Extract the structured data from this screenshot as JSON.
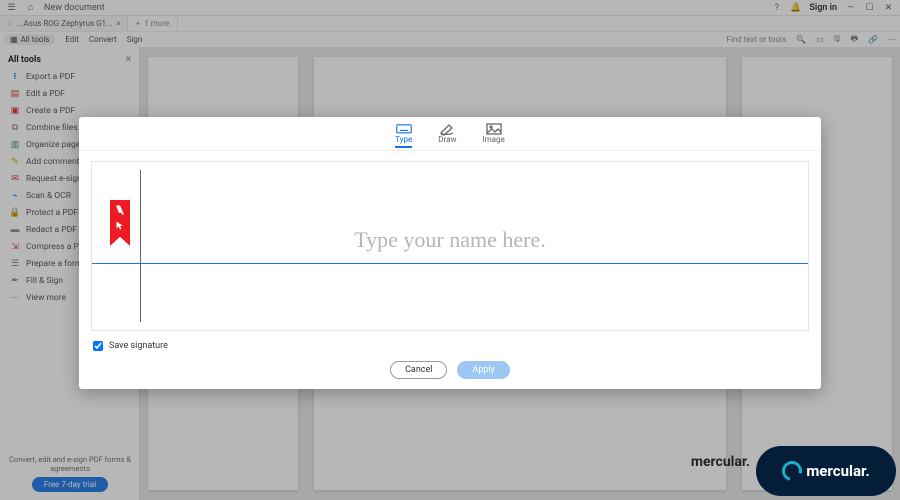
{
  "titlebar": {
    "doc_title": "New document",
    "sign_in": "Sign in"
  },
  "tabs": {
    "items": [
      {
        "label": "...Asus ROG Zephyrus G1..."
      }
    ],
    "more": "1 more"
  },
  "toolbar": {
    "all_tools": "All tools",
    "edit": "Edit",
    "convert": "Convert",
    "sign": "Sign",
    "find": "Find text or tools"
  },
  "sidebar": {
    "title": "All tools",
    "items": [
      {
        "label": "Export a PDF"
      },
      {
        "label": "Edit a PDF"
      },
      {
        "label": "Create a PDF"
      },
      {
        "label": "Combine files"
      },
      {
        "label": "Organize pages"
      },
      {
        "label": "Add comments"
      },
      {
        "label": "Request e-signatures"
      },
      {
        "label": "Scan & OCR"
      },
      {
        "label": "Protect a PDF"
      },
      {
        "label": "Redact a PDF"
      },
      {
        "label": "Compress a PDF"
      },
      {
        "label": "Prepare a form"
      },
      {
        "label": "Fill & Sign"
      },
      {
        "label": "View more"
      }
    ],
    "footer_text": "Convert, edit and e-sign PDF forms & agreements",
    "trial": "Free 7-day trial"
  },
  "modal": {
    "tabs": [
      {
        "label": "Type"
      },
      {
        "label": "Draw"
      },
      {
        "label": "Image"
      }
    ],
    "placeholder": "Type your name here.",
    "save_label": "Save signature",
    "cancel": "Cancel",
    "apply": "Apply"
  },
  "watermark": {
    "brand": "mercular."
  }
}
